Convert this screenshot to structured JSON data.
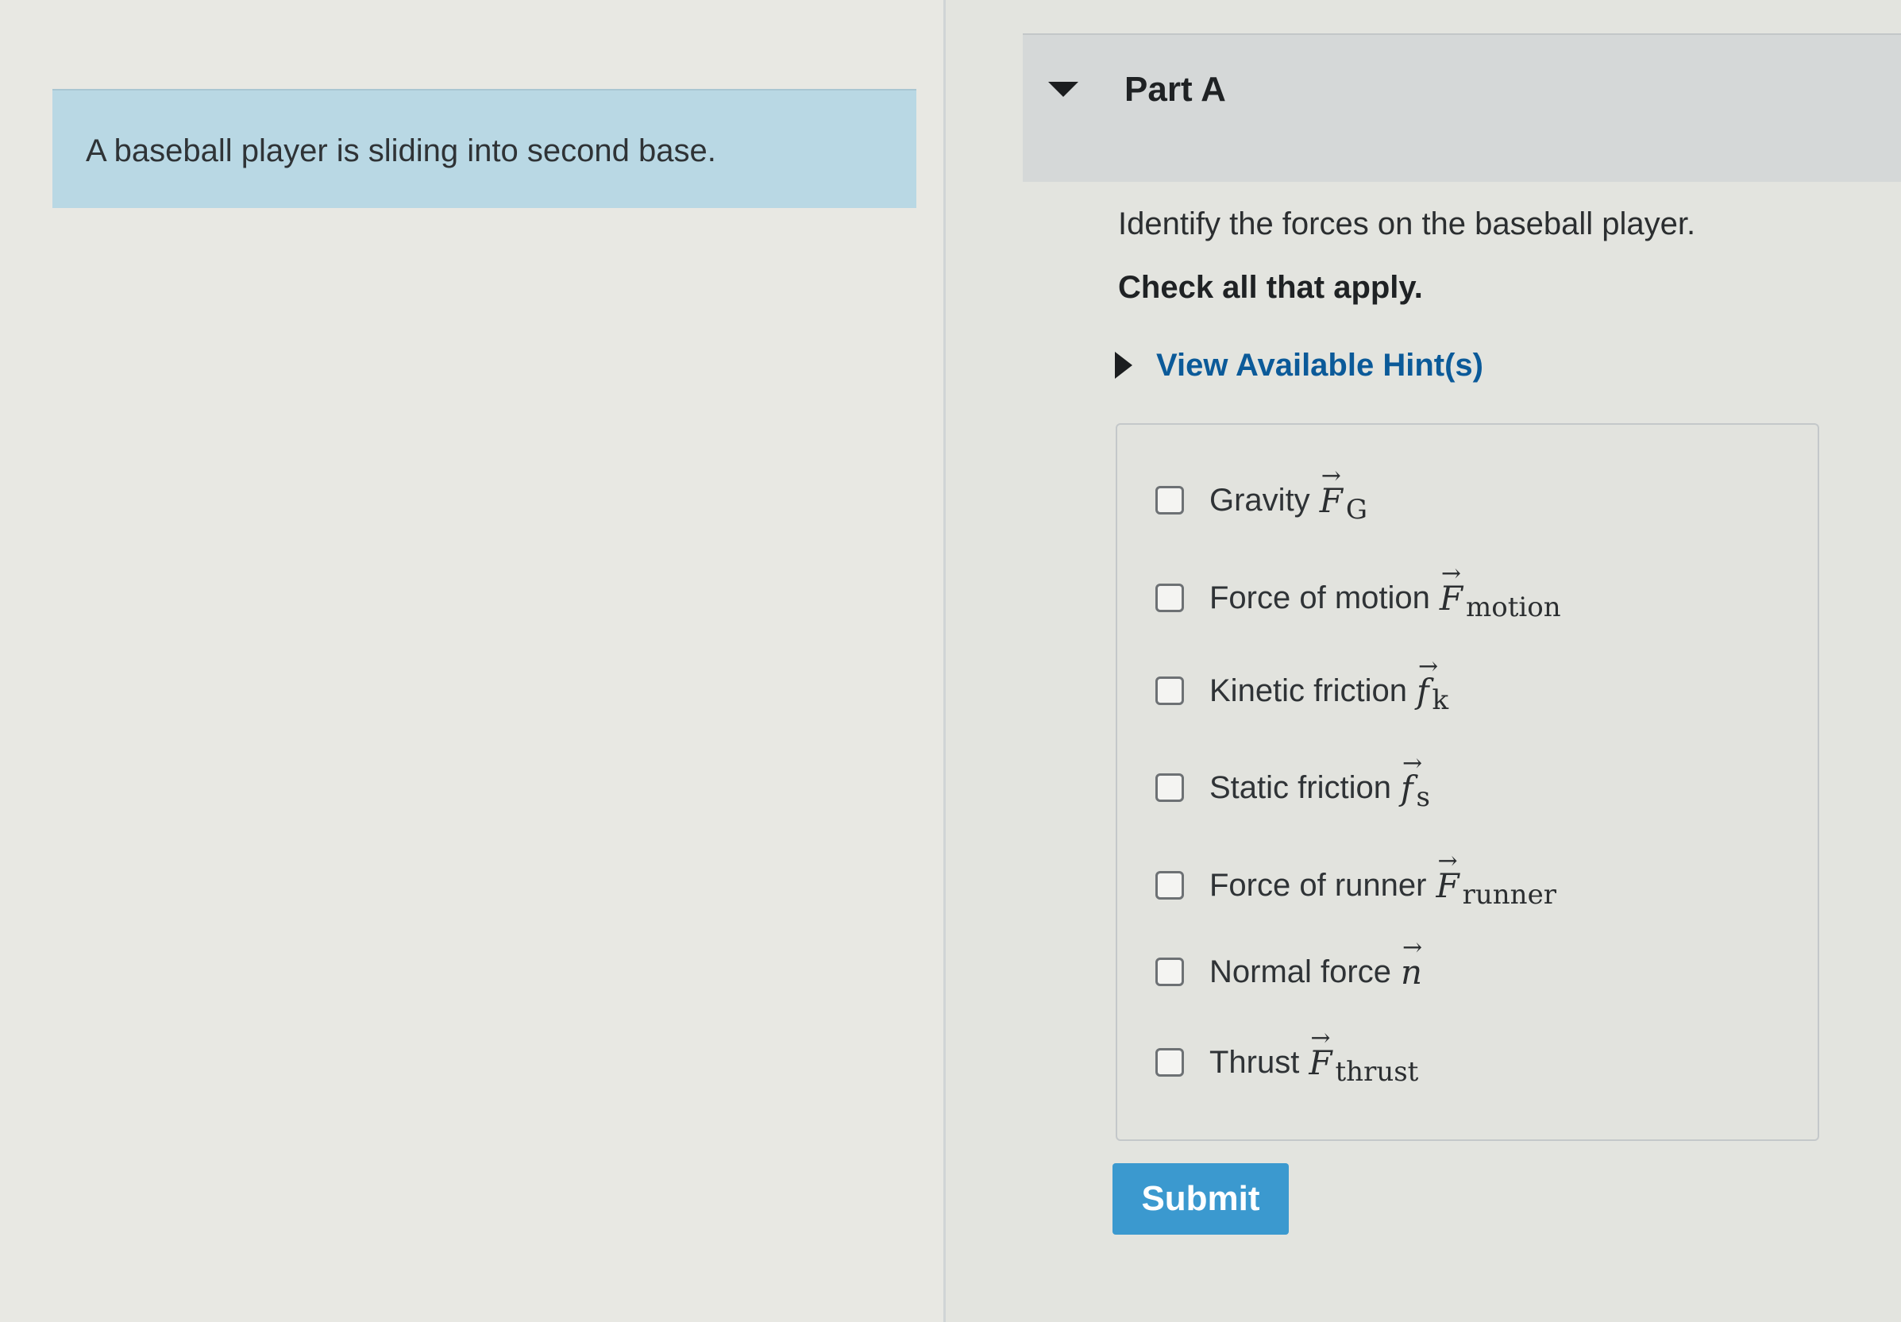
{
  "problem": {
    "text": "A baseball player is sliding into second base."
  },
  "part": {
    "title": "Part A",
    "caret_icon": "caret-down-icon"
  },
  "question": {
    "prompt": "Identify the forces on the baseball player.",
    "instruction": "Check all that apply."
  },
  "hint": {
    "label": "View Available Hint(s)",
    "caret_icon": "caret-right-icon"
  },
  "choices": [
    {
      "label": "Gravity",
      "symbol": "F",
      "subscript": "G",
      "checked": false
    },
    {
      "label": "Force of motion",
      "symbol": "F",
      "subscript": "motion",
      "checked": false
    },
    {
      "label": "Kinetic friction",
      "symbol": "f",
      "subscript": "k",
      "checked": false
    },
    {
      "label": "Static friction",
      "symbol": "f",
      "subscript": "s",
      "checked": false
    },
    {
      "label": "Force of runner",
      "symbol": "F",
      "subscript": "runner",
      "checked": false
    },
    {
      "label": "Normal force",
      "symbol": "n",
      "subscript": "",
      "checked": false
    },
    {
      "label": "Thrust",
      "symbol": "F",
      "subscript": "thrust",
      "checked": false
    }
  ],
  "submit": {
    "label": "Submit"
  },
  "colors": {
    "problem_background": "#b9d8e4",
    "hint_link": "#0b5a99",
    "submit_background": "#3b99cf"
  }
}
